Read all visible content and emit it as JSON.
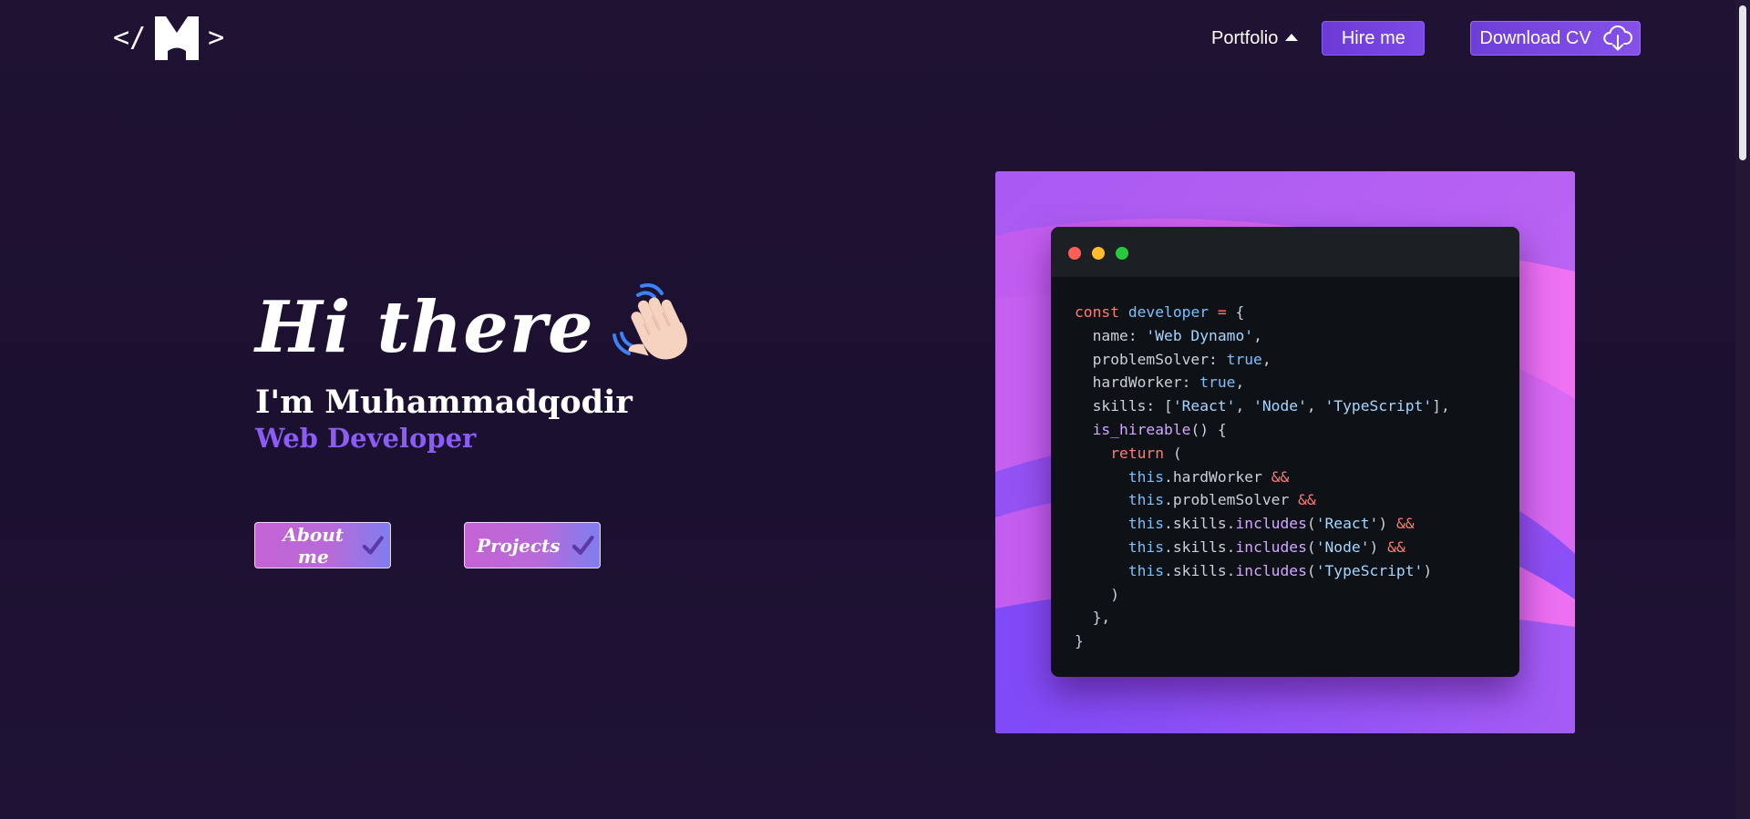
{
  "header": {
    "logo_open": "</",
    "logo_close": ">",
    "logo_letter": "M",
    "nav_portfolio": "Portfolio",
    "hire_label": "Hire me",
    "cv_label": "Download CV",
    "cv_icon": "cloud-download-icon"
  },
  "hero": {
    "greeting": "Hi there",
    "greeting_icon": "waving-hand-icon",
    "intro": "I'm Muhammadqodir",
    "role": "Web Developer",
    "buttons": [
      {
        "label": "About me",
        "icon": "check-icon"
      },
      {
        "label": "Projects",
        "icon": "check-icon"
      }
    ]
  },
  "code_card": {
    "window_dots": [
      "#ff5f57",
      "#febc2e",
      "#28c840"
    ],
    "lines": [
      [
        [
          "kw",
          "const "
        ],
        [
          "var",
          "developer "
        ],
        [
          "kw",
          "= "
        ],
        [
          "pl",
          "{"
        ]
      ],
      [
        [
          "pl",
          "  name: "
        ],
        [
          "str",
          "'Web Dynamo'"
        ],
        [
          "pl",
          ","
        ]
      ],
      [
        [
          "pl",
          "  problemSolver: "
        ],
        [
          "var",
          "true"
        ],
        [
          "pl",
          ","
        ]
      ],
      [
        [
          "pl",
          "  hardWorker: "
        ],
        [
          "var",
          "true"
        ],
        [
          "pl",
          ","
        ]
      ],
      [
        [
          "pl",
          "  skills: ["
        ],
        [
          "str",
          "'React'"
        ],
        [
          "pl",
          ", "
        ],
        [
          "str",
          "'Node'"
        ],
        [
          "pl",
          ", "
        ],
        [
          "str",
          "'TypeScript'"
        ],
        [
          "pl",
          "],"
        ]
      ],
      [
        [
          "pl",
          "  "
        ],
        [
          "fn",
          "is_hireable"
        ],
        [
          "pl",
          "() {"
        ]
      ],
      [
        [
          "pl",
          "    "
        ],
        [
          "kw",
          "return "
        ],
        [
          "pl",
          "("
        ]
      ],
      [
        [
          "pl",
          "      "
        ],
        [
          "var",
          "this"
        ],
        [
          "pl",
          ".hardWorker "
        ],
        [
          "kw",
          "&&"
        ]
      ],
      [
        [
          "pl",
          "      "
        ],
        [
          "var",
          "this"
        ],
        [
          "pl",
          ".problemSolver "
        ],
        [
          "kw",
          "&&"
        ]
      ],
      [
        [
          "pl",
          "      "
        ],
        [
          "var",
          "this"
        ],
        [
          "pl",
          ".skills."
        ],
        [
          "fn",
          "includes"
        ],
        [
          "pl",
          "("
        ],
        [
          "str",
          "'React'"
        ],
        [
          "pl",
          ") "
        ],
        [
          "kw",
          "&&"
        ]
      ],
      [
        [
          "pl",
          "      "
        ],
        [
          "var",
          "this"
        ],
        [
          "pl",
          ".skills."
        ],
        [
          "fn",
          "includes"
        ],
        [
          "pl",
          "("
        ],
        [
          "str",
          "'Node'"
        ],
        [
          "pl",
          ") "
        ],
        [
          "kw",
          "&&"
        ]
      ],
      [
        [
          "pl",
          "      "
        ],
        [
          "var",
          "this"
        ],
        [
          "pl",
          ".skills."
        ],
        [
          "fn",
          "includes"
        ],
        [
          "pl",
          "("
        ],
        [
          "str",
          "'TypeScript'"
        ],
        [
          "pl",
          ")"
        ]
      ],
      [
        [
          "pl",
          "    )"
        ]
      ],
      [
        [
          "pl",
          "  },"
        ]
      ],
      [
        [
          "pl",
          "}"
        ]
      ]
    ]
  },
  "colors": {
    "background": "#1d1131",
    "accent": "#8b5cf6",
    "card_gradient_start": "#ae5cf3",
    "card_gradient_end": "#ef73f2"
  }
}
